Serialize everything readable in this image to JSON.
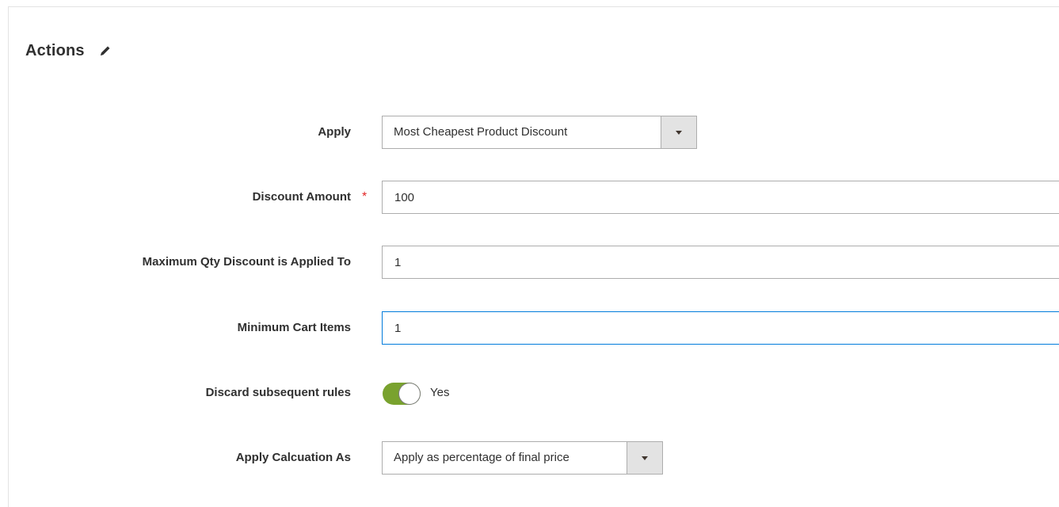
{
  "section": {
    "title": "Actions",
    "edit_icon": "pencil-icon"
  },
  "fields": {
    "apply": {
      "label": "Apply",
      "value": "Most Cheapest Product Discount",
      "arrow_icon": "chevron-down-icon"
    },
    "discount_amount": {
      "label": "Discount Amount",
      "required_mark": "*",
      "value": "100"
    },
    "max_qty": {
      "label": "Maximum Qty Discount is Applied To",
      "value": "1"
    },
    "min_cart_items": {
      "label": "Minimum Cart Items",
      "value": "1"
    },
    "discard_rules": {
      "label": "Discard subsequent rules",
      "toggle_state": "on",
      "toggle_text": "Yes"
    },
    "apply_calculation": {
      "label": "Apply Calcuation As",
      "value": "Apply as percentage of final price",
      "arrow_icon": "chevron-down-icon"
    }
  },
  "colors": {
    "toggle_on": "#79a22e",
    "focus_border": "#007bdb",
    "required": "#e22626",
    "border": "#adadad"
  }
}
